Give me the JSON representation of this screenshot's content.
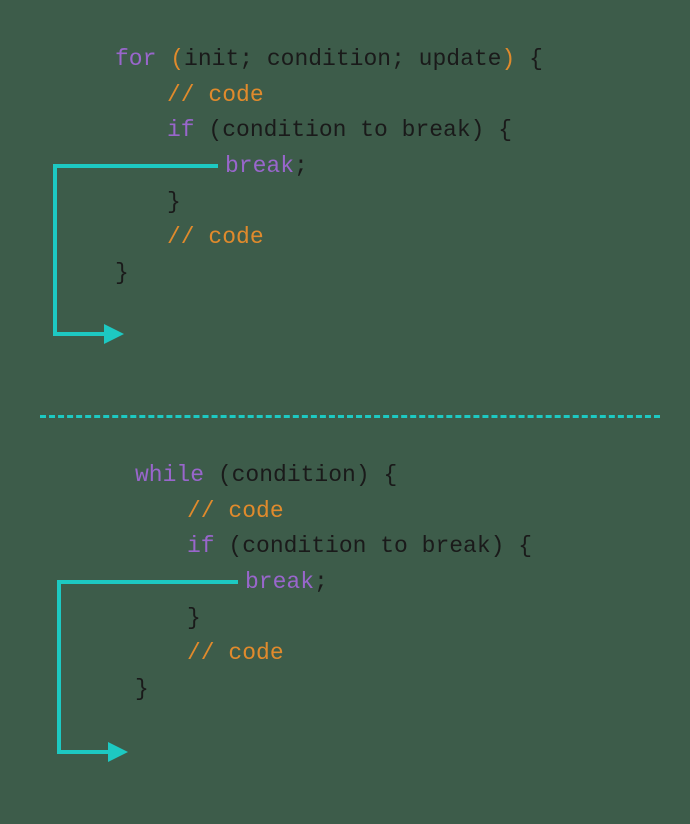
{
  "diagram": {
    "for_block": {
      "keyword_for": "for",
      "paren_open": " (",
      "header_args": "init; condition; update",
      "paren_close": ") ",
      "brace_open": "{",
      "comment1": "// code",
      "keyword_if": "if",
      "if_cond": " (condition to break) {",
      "keyword_break": "break",
      "semicolon": ";",
      "brace_close_inner": "}",
      "comment2": "// code",
      "brace_close_outer": "}"
    },
    "while_block": {
      "keyword_while": "while",
      "header_cond": " (condition) {",
      "comment1": "// code",
      "keyword_if": "if",
      "if_cond": " (condition to break) {",
      "keyword_break": "break",
      "semicolon": ";",
      "brace_close_inner": "}",
      "comment2": "// code",
      "brace_close_outer": "}"
    },
    "colors": {
      "background": "#3d5c4a",
      "purple": "#9966cc",
      "orange": "#e08a2c",
      "black": "#1a1a1a",
      "arrow": "#1dc9c2"
    }
  }
}
